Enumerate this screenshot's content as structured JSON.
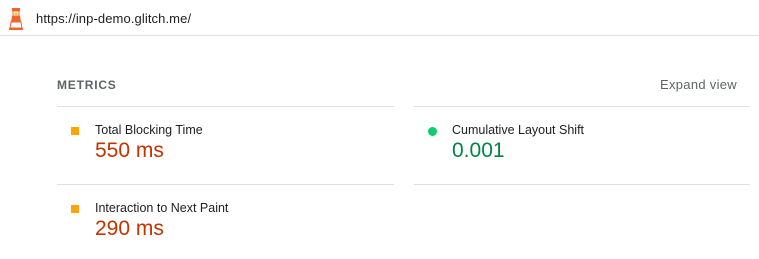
{
  "address_bar": {
    "icon": "lighthouse-icon",
    "url": "https://inp-demo.glitch.me/"
  },
  "metrics_section": {
    "heading": "METRICS",
    "expand_label": "Expand view",
    "items": [
      {
        "label": "Total Blocking Time",
        "value": "550 ms",
        "status": "average",
        "marker": "square",
        "marker_color": "#ffa400",
        "value_color": "#c33300"
      },
      {
        "label": "Cumulative Layout Shift",
        "value": "0.001",
        "status": "pass",
        "marker": "circle",
        "marker_color": "#0cce6b",
        "value_color": "#018642"
      },
      {
        "label": "Interaction to Next Paint",
        "value": "290 ms",
        "status": "average",
        "marker": "square",
        "marker_color": "#ffa400",
        "value_color": "#c33300"
      }
    ]
  }
}
